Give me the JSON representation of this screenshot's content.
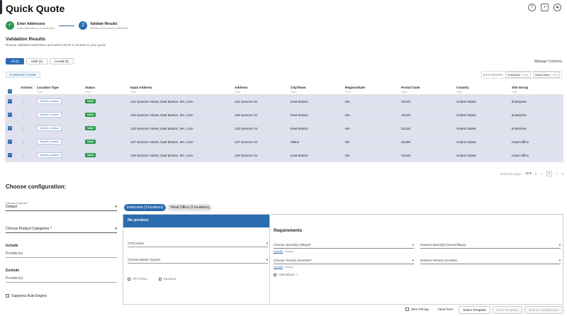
{
  "header": {
    "title": "Quick Quote"
  },
  "stepper": [
    {
      "title": "Enter Addresses",
      "subtitle": "Add addresses or coordinates",
      "icon": "✓"
    },
    {
      "title": "Validate Results",
      "subtitle": "Review and correct addresses",
      "icon": "2"
    }
  ],
  "validation": {
    "title": "Validation Results",
    "subtitle": "Review validated addresses and select which to include in your quote"
  },
  "tabs": [
    "All (5)",
    "Valid (5)",
    "Invalid (0)"
  ],
  "manage_columns": "Manage Columns",
  "selected_count": "5 selected / 5 total",
  "site_groups": {
    "label": "SITE GROUPS:",
    "items": [
      {
        "name": "Enterprise",
        "count": "3 sites"
      },
      {
        "name": "Head Office",
        "count": "2 sites"
      }
    ]
  },
  "table": {
    "columns": [
      "Actions",
      "Location Type",
      "Status",
      "Input Address",
      "Address",
      "City/Town",
      "Region/State",
      "Postal Code",
      "Country",
      "Site Group"
    ],
    "filter_placeholder": "Filter",
    "rows": [
      {
        "type": "Simple Location",
        "status": "Valid",
        "input": "134 Summer Street, East Boston, MA, USA",
        "address": "134 Summer St",
        "city": "East Boston",
        "region": "MA",
        "postal": "02128",
        "country": "United States",
        "group": "Enterprise"
      },
      {
        "type": "Simple Location",
        "status": "Valid",
        "input": "135 Summer Street, East Boston, MA, USA",
        "address": "135 Summer St",
        "city": "East Boston",
        "region": "MA",
        "postal": "02128",
        "country": "United States",
        "group": "Enterprise"
      },
      {
        "type": "Simple Location",
        "status": "Valid",
        "input": "136 Summer Street, East Boston, MA, USA",
        "address": "136 Summer St",
        "city": "East Boston",
        "region": "MA",
        "postal": "02128",
        "country": "United States",
        "group": "Enterprise"
      },
      {
        "type": "Simple Location",
        "status": "Valid",
        "input": "137 Summer Street, East Boston, MA, USA",
        "address": "137 Summer St",
        "city": "Milton",
        "region": "MA",
        "postal": "02186",
        "country": "United States",
        "group": "Head Office"
      },
      {
        "type": "Simple Location",
        "status": "Valid",
        "input": "138 Summer Street, East Boston, MA, USA",
        "address": "138 Summer St",
        "city": "East Boston",
        "region": "MA",
        "postal": "02128",
        "country": "United States",
        "group": "Head Office"
      }
    ]
  },
  "pager": {
    "items_label": "Items per page:",
    "per_page": "10",
    "page": "1"
  },
  "config": {
    "title": "Choose configuration:",
    "channel_label": "Choose Channel *",
    "channel_value": "Default",
    "product_categories": "Choose Product Categories *",
    "include_label": "Include",
    "include_placeholder": "Provider(s)",
    "exclude_label": "Exclude",
    "exclude_placeholder": "Provider(s)",
    "suppress": "Suppress Rule Engine"
  },
  "group_tabs": [
    "Enterprise (3 locations)",
    "Head Office (2 locations)"
  ],
  "product": {
    "header": "No product",
    "cpq_rules": "CPQ Rules",
    "media_type": "Choose Media Type(s)",
    "api_pricing": "API Pricing",
    "required": "Required"
  },
  "requirements": {
    "title": "Requirements",
    "speed": "Choose Speed(s) (Mbps)*",
    "desired_speed": "Desired Speed(s) (Down/Mbps)",
    "term": "Choose Term(s) (months)*",
    "desired_term": "Desired Term(s) (months)",
    "specific": "Specific",
    "range": "/ Range",
    "alternatives": "Alternatives"
  },
  "footer": {
    "zero_pricing": "Zero Pricing",
    "clear": "Clear form",
    "select_template": "Select Template",
    "save_template": "Save Template",
    "submit": "Submit Configuration"
  }
}
